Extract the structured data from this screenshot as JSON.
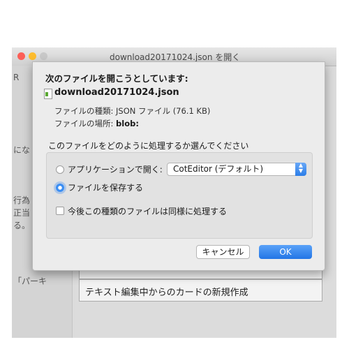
{
  "window": {
    "title": "download20171024.json を開く"
  },
  "background_app": {
    "left_fragments": [
      "Rt",
      "R",
      "にな",
      "行為",
      "正当",
      "る。",
      "「パーキ"
    ],
    "bottom_text": "テキスト編集中からのカードの新規作成"
  },
  "dialog": {
    "heading": "次のファイルを開こうとしています:",
    "file": {
      "name": "download20171024.json",
      "type_label": "ファイルの種類:",
      "type_value": "JSON ファイル (76.1 KB)",
      "location_label": "ファイルの場所:",
      "location_value": "blob:"
    },
    "question": "このファイルをどのように処理するか選んでください",
    "options": {
      "open_with_label": "アプリケーションで開く:",
      "app_selected": "CotEditor (デフォルト)",
      "save_label": "ファイルを保存する",
      "save_selected": true,
      "remember_label": "今後この種類のファイルは同様に処理する",
      "remember_checked": false
    },
    "buttons": {
      "cancel": "キャンセル",
      "ok": "OK"
    }
  },
  "colors": {
    "accent": "#2a7de8",
    "dialog_bg": "#ececec",
    "group_bg": "#e2e2e2"
  }
}
